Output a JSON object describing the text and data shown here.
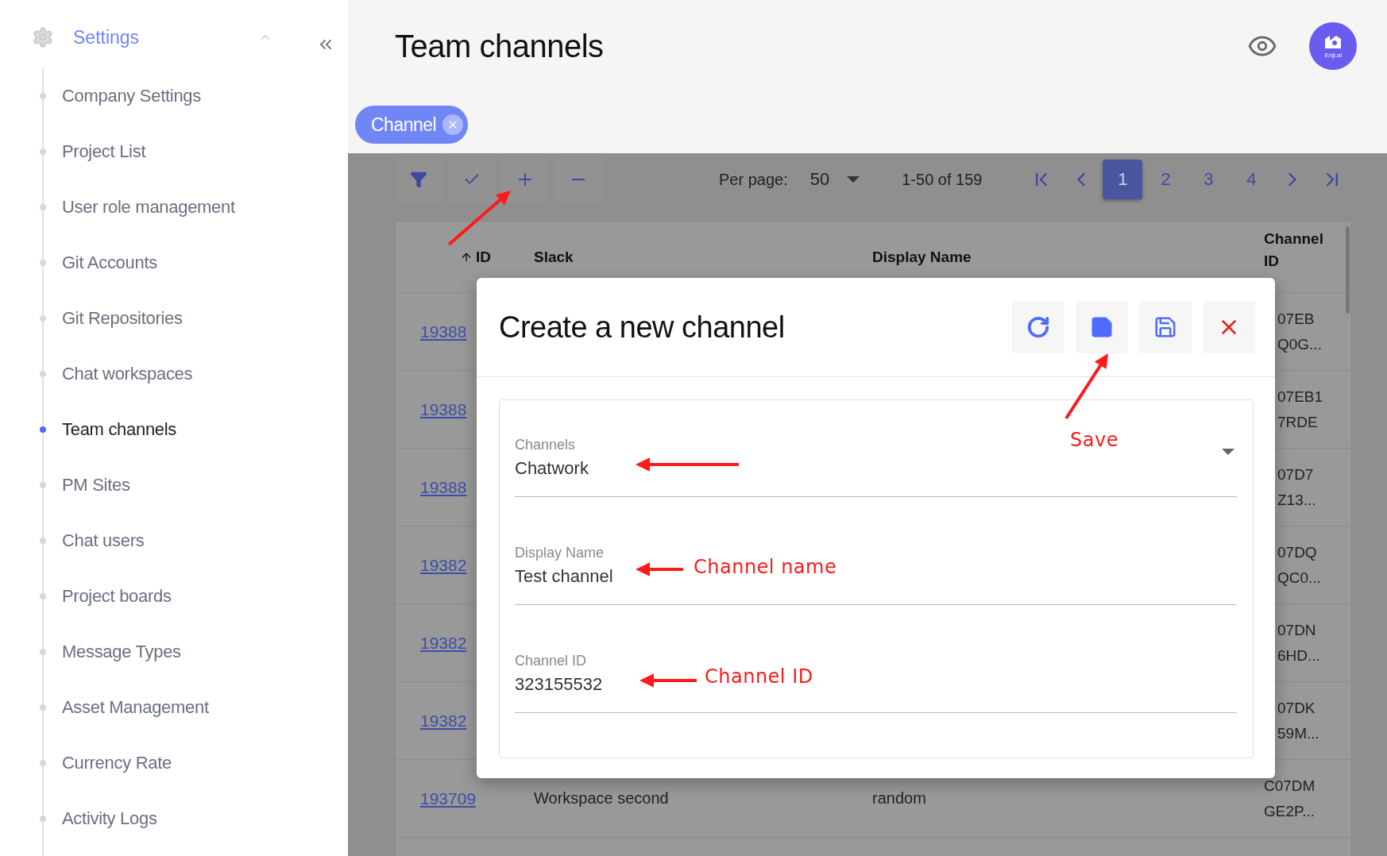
{
  "sidebar": {
    "section": {
      "label": "Settings",
      "expanded": true
    },
    "items": [
      {
        "label": "Company Settings",
        "selected": false
      },
      {
        "label": "Project List",
        "selected": false
      },
      {
        "label": "User role management",
        "selected": false
      },
      {
        "label": "Git Accounts",
        "selected": false
      },
      {
        "label": "Git Repositories",
        "selected": false
      },
      {
        "label": "Chat workspaces",
        "selected": false
      },
      {
        "label": "Team channels",
        "selected": true
      },
      {
        "label": "PM Sites",
        "selected": false
      },
      {
        "label": "Chat users",
        "selected": false
      },
      {
        "label": "Project boards",
        "selected": false
      },
      {
        "label": "Message Types",
        "selected": false
      },
      {
        "label": "Asset Management",
        "selected": false
      },
      {
        "label": "Currency Rate",
        "selected": false
      },
      {
        "label": "Activity Logs",
        "selected": false
      }
    ]
  },
  "header": {
    "title": "Team channels",
    "avatar_text": "Enji.ai"
  },
  "filters": [
    {
      "label": "Channel"
    }
  ],
  "toolbar": {
    "per_page_label": "Per page:",
    "per_page": "50",
    "range": "1-50 of 159",
    "pages": [
      {
        "label": "1",
        "selected": true
      },
      {
        "label": "2",
        "selected": false
      },
      {
        "label": "3",
        "selected": false
      },
      {
        "label": "4",
        "selected": false
      }
    ]
  },
  "table": {
    "columns": [
      {
        "label": "ID",
        "sorted": true
      },
      {
        "label": "Slack",
        "sorted": false
      },
      {
        "label": "Display Name",
        "sorted": false
      },
      {
        "label": "Channel ID",
        "sorted": false
      }
    ],
    "rows": [
      {
        "id": "19388",
        "slack": "",
        "display_name": "",
        "channel_id": "07EB Q0G...",
        "covered": true
      },
      {
        "id": "19388",
        "slack": "",
        "display_name": "",
        "channel_id": "07EB1 7RDE",
        "covered": true
      },
      {
        "id": "19388",
        "slack": "",
        "display_name": "",
        "channel_id": "07D7 Z13...",
        "covered": true
      },
      {
        "id": "19382",
        "slack": "",
        "display_name": "",
        "channel_id": "07DQ QC0...",
        "covered": true
      },
      {
        "id": "19382",
        "slack": "",
        "display_name": "",
        "channel_id": "07DN 6HD...",
        "covered": true
      },
      {
        "id": "19382",
        "slack": "",
        "display_name": "",
        "channel_id": "07DK 59M...",
        "covered": true
      },
      {
        "id": "193709",
        "slack": "Workspace second",
        "display_name": "random",
        "channel_id": "C07DM GE2P...",
        "covered": false
      }
    ]
  },
  "dialog": {
    "title": "Create a new channel",
    "fields": [
      {
        "kind": "select",
        "label": "Channels",
        "value": "Chatwork"
      },
      {
        "kind": "text",
        "label": "Display Name",
        "value": "Test channel"
      },
      {
        "kind": "text",
        "label": "Channel ID",
        "value": "323155532"
      }
    ]
  },
  "annotations": [
    {
      "kind": "arrow"
    },
    {
      "kind": "label",
      "text": "Save"
    },
    {
      "kind": "arrow"
    },
    {
      "kind": "label",
      "text": "Channel name"
    },
    {
      "kind": "label",
      "text": "Channel ID"
    }
  ]
}
